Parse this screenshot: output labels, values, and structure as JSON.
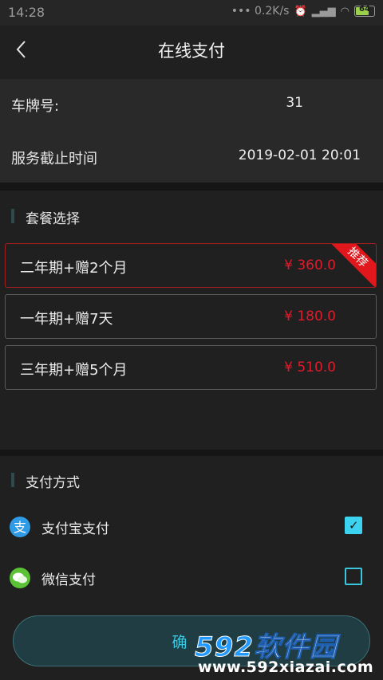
{
  "status_bar": {
    "time": "14:28",
    "network_speed": "••• 0.2K/s",
    "battery": "64",
    "icons": [
      "alarm-icon",
      "bluetooth-icon",
      "signal-icon",
      "wifi-icon"
    ]
  },
  "header": {
    "title": "在线支付",
    "back_icon": "chevron-left-icon"
  },
  "info": {
    "plate_label": "车牌号:",
    "plate_value": "31",
    "deadline_label": "服务截止时间",
    "deadline_value": "2019-02-01 20:01"
  },
  "packages": {
    "title": "套餐选择",
    "items": [
      {
        "name": "二年期+赠2个月",
        "price": "¥ 360.0",
        "badge": "推荐",
        "selected": true
      },
      {
        "name": "一年期+赠7天",
        "price": "¥ 180.0",
        "selected": false
      },
      {
        "name": "三年期+赠5个月",
        "price": "¥ 510.0",
        "selected": false
      }
    ]
  },
  "payment": {
    "title": "支付方式",
    "methods": [
      {
        "label": "支付宝支付",
        "icon": "alipay-icon",
        "checked": true
      },
      {
        "label": "微信支付",
        "icon": "wechat-icon",
        "checked": false
      }
    ]
  },
  "confirm_button": {
    "label": "确"
  },
  "watermark": {
    "big_num": "592",
    "big_cn": "软件园",
    "url": "www.592xiazai.com"
  },
  "colors": {
    "price_red": "#e3192a",
    "accent_cyan": "#3bd3ef",
    "badge_red": "#e0171c"
  }
}
